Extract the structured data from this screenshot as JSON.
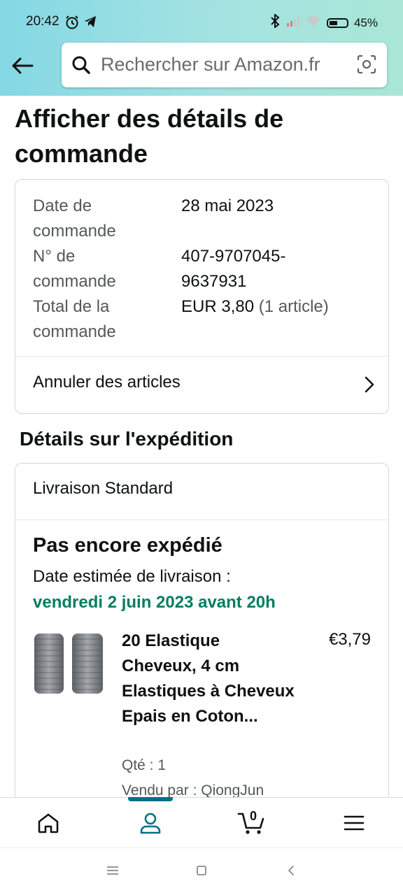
{
  "status_bar": {
    "time": "20:42",
    "battery": "45%"
  },
  "search": {
    "placeholder": "Rechercher sur Amazon.fr"
  },
  "page": {
    "title": "Afficher des détails de commande"
  },
  "order": {
    "date_label": "Date de commande",
    "date_value": "28 mai 2023",
    "number_label": "N° de commande",
    "number_value_line1": "407-9707045-",
    "number_value_line2": "9637931",
    "total_label": "Total de la commande",
    "total_value": "EUR 3,80",
    "total_items": "(1 article)",
    "cancel_label": "Annuler des articles"
  },
  "shipment": {
    "section_title": "Détails sur l'expédition",
    "method": "Livraison Standard",
    "status": "Pas encore expédié",
    "estimate_label": "Date estimée de livraison :",
    "estimate_date": "vendredi 2 juin 2023 avant 20h"
  },
  "product": {
    "title": "20 Elastique Cheveux, 4 cm Elastiques à Cheveux Epais en Coton...",
    "price": "€3,79",
    "qty": "Qté : 1",
    "seller": "Vendu par : QiongJun"
  },
  "nav": {
    "cart_count": "0"
  },
  "colors": {
    "accent": "#007185",
    "delivery_green": "#067d62"
  }
}
